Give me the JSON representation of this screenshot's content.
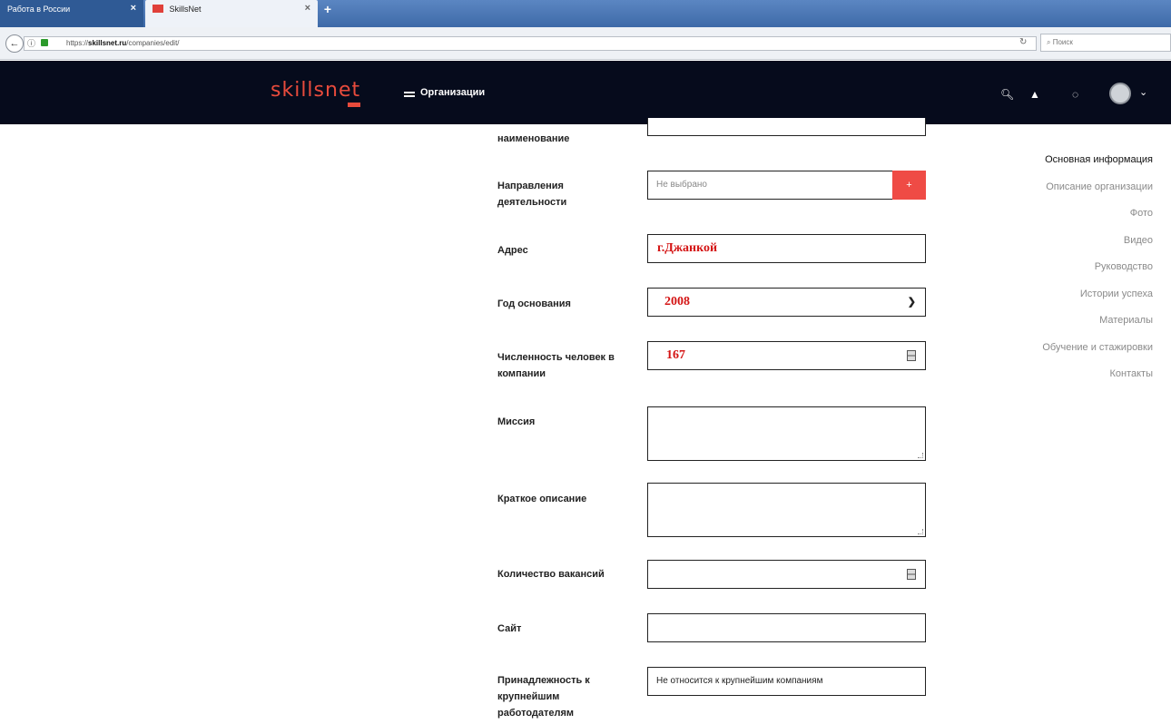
{
  "browser": {
    "tabs": [
      {
        "label": "Работа в России"
      },
      {
        "label": "SkillsNet"
      }
    ],
    "url_prefix": "https://",
    "url_host": "skillsnet.ru",
    "url_path": "/companies/edit/",
    "search_placeholder": "Поиск"
  },
  "header": {
    "logo": "skillsnet",
    "menu_label": "Организации"
  },
  "form": {
    "name_label": "наименование",
    "directions_label": "Направления деятельности",
    "directions_placeholder": "Не выбрано",
    "directions_add": "+",
    "address_label": "Адрес",
    "address_value": "г.Джанкой",
    "founded_label": "Год основания",
    "founded_value": "2008",
    "employees_label": "Численность человек в компании",
    "employees_value": "167",
    "mission_label": "Миссия",
    "summary_label": "Краткое описание",
    "vacancies_label": "Количество вакансий",
    "site_label": "Сайт",
    "affiliation_label": "Принадлежность к крупнейшим работодателям",
    "affiliation_value": "Не относится к крупнейшим компаниям"
  },
  "side_nav": {
    "items": [
      {
        "label": "Основная информация",
        "active": true
      },
      {
        "label": "Описание организации",
        "active": false
      },
      {
        "label": "Фото",
        "active": false
      },
      {
        "label": "Видео",
        "active": false
      },
      {
        "label": "Руководство",
        "active": false
      },
      {
        "label": "Истории успеха",
        "active": false
      },
      {
        "label": "Материалы",
        "active": false
      },
      {
        "label": "Обучение и стажировки",
        "active": false
      },
      {
        "label": "Контакты",
        "active": false
      }
    ]
  },
  "colors": {
    "accent": "#ef4b45",
    "header_bg": "#060b1c",
    "value_red": "#d41414"
  }
}
